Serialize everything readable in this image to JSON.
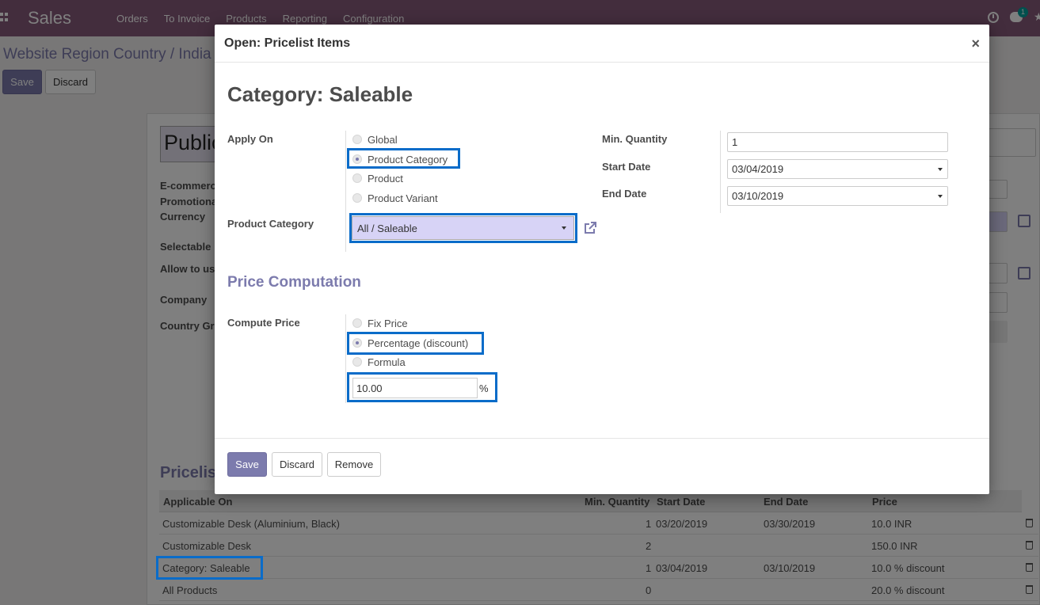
{
  "navbar": {
    "brand": "Sales",
    "menu": [
      "Orders",
      "To Invoice",
      "Products",
      "Reporting",
      "Configuration"
    ],
    "chat_badge": "1"
  },
  "background": {
    "breadcrumb": "Website Region Country / India /",
    "save_label": "Save",
    "discard_label": "Discard",
    "record_title": "Public",
    "fields": [
      "E-commerce",
      "Promotional",
      "Currency",
      "Selectable",
      "Allow to us",
      "Company",
      "Country Gr"
    ],
    "section_title": "Pricelis",
    "table": {
      "headers": [
        "Applicable On",
        "Min. Quantity",
        "Start Date",
        "End Date",
        "Price"
      ],
      "rows": [
        {
          "applicable_on": "Customizable Desk (Aluminium, Black)",
          "min_qty": "1",
          "start": "03/20/2019",
          "end": "03/30/2019",
          "price": "10.0 INR"
        },
        {
          "applicable_on": "Customizable Desk",
          "min_qty": "2",
          "start": "",
          "end": "",
          "price": "150.0 INR"
        },
        {
          "applicable_on": "Category: Saleable",
          "min_qty": "1",
          "start": "03/04/2019",
          "end": "03/10/2019",
          "price": "10.0 % discount"
        },
        {
          "applicable_on": "All Products",
          "min_qty": "0",
          "start": "",
          "end": "",
          "price": "20.0 % discount"
        }
      ]
    }
  },
  "modal": {
    "title": "Open: Pricelist Items",
    "close": "×",
    "record_title": "Category: Saleable",
    "apply_on": {
      "label": "Apply On",
      "options": [
        "Global",
        "Product Category",
        "Product",
        "Product Variant"
      ],
      "selected": "Product Category"
    },
    "product_category": {
      "label": "Product Category",
      "value": "All / Saleable"
    },
    "min_quantity": {
      "label": "Min. Quantity",
      "value": "1"
    },
    "start_date": {
      "label": "Start Date",
      "value": "03/04/2019"
    },
    "end_date": {
      "label": "End Date",
      "value": "03/10/2019"
    },
    "price_computation_title": "Price Computation",
    "compute_price": {
      "label": "Compute Price",
      "options": [
        "Fix Price",
        "Percentage (discount)",
        "Formula"
      ],
      "selected": "Percentage (discount)"
    },
    "percentage": {
      "value": "10.00",
      "unit": "%"
    },
    "buttons": {
      "save": "Save",
      "discard": "Discard",
      "remove": "Remove"
    }
  },
  "colors": {
    "brand": "#875a7b",
    "primary": "#7c7bad",
    "highlight": "#0a6cc9",
    "selection_bg": "#d7d3f6"
  }
}
